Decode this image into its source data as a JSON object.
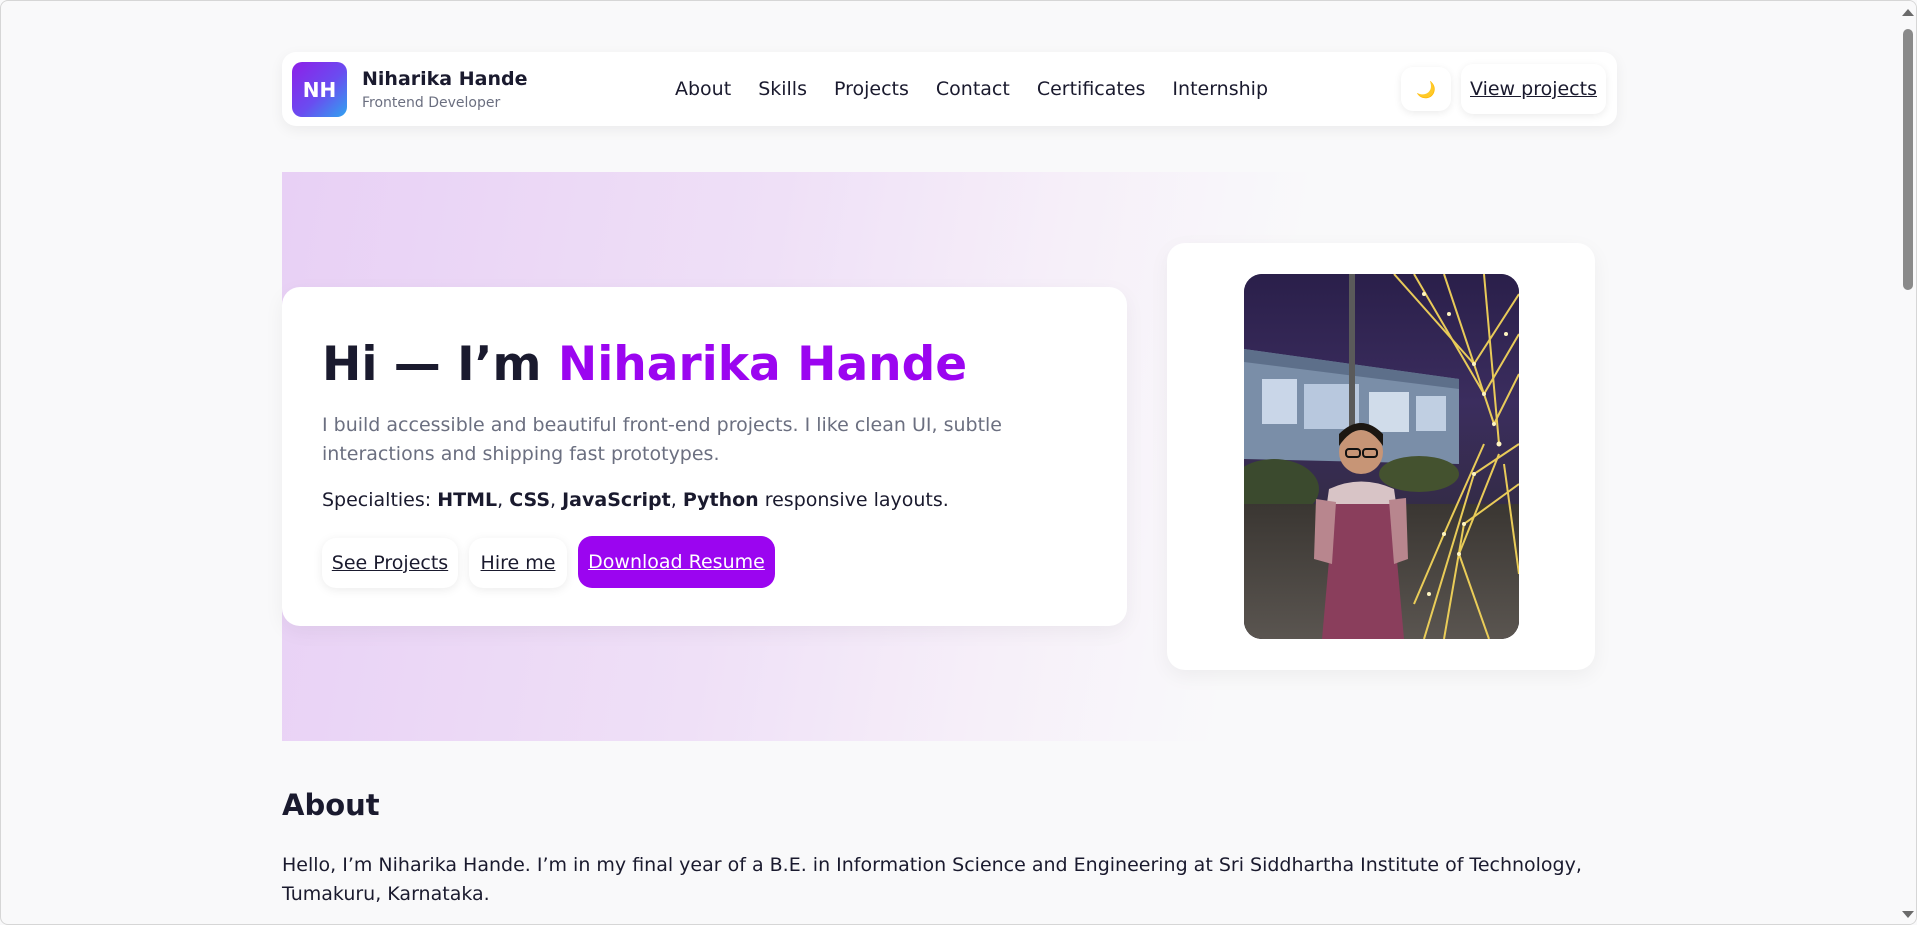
{
  "header": {
    "logo_initials": "NH",
    "brand_name": "Niharika Hande",
    "brand_role": "Frontend Developer",
    "nav": [
      "About",
      "Skills",
      "Projects",
      "Contact",
      "Certificates",
      "Internship"
    ],
    "theme_toggle_icon": "🌙",
    "cta_label": "View projects"
  },
  "hero": {
    "title_prefix": "Hi — I’m ",
    "title_name": "Niharika Hande",
    "description": "I build accessible and beautiful front-end projects. I like clean UI, subtle interactions and shipping fast prototypes.",
    "specialties_label": "Specialties: ",
    "specialties": [
      "HTML",
      "CSS",
      "JavaScript",
      "Python"
    ],
    "specialties_suffix": " responsive layouts.",
    "buttons": {
      "see_projects": "See Projects",
      "hire_me": "Hire me",
      "download_resume": "Download Resume"
    }
  },
  "about": {
    "title": "About",
    "text": "Hello, I’m Niharika Hande. I’m in my final year of a B.E. in Information Science and Engineering at Sri Siddhartha Institute of Technology, Tumakuru, Karnataka."
  },
  "colors": {
    "accent": "#9b05f0",
    "text": "#1a1a2e",
    "muted": "#6b6f80",
    "background": "#f9f9fa"
  }
}
